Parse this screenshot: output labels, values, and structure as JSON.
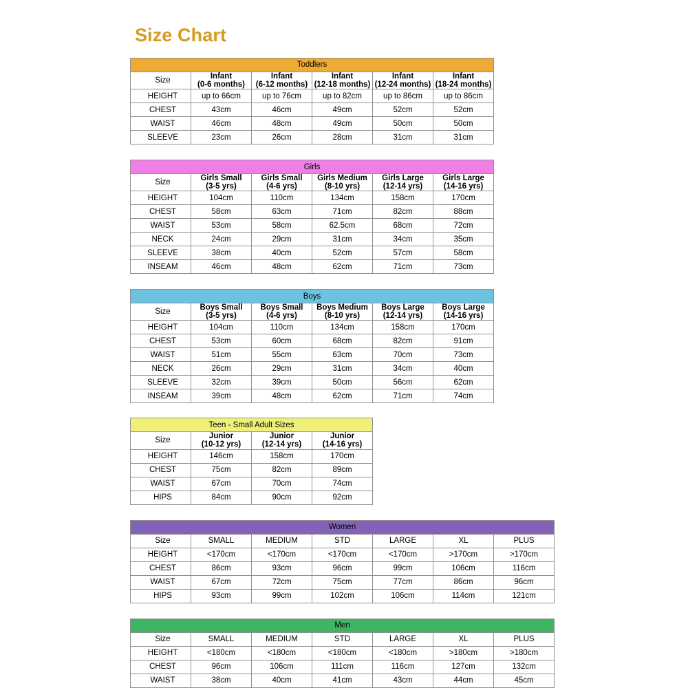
{
  "page": {
    "title": "Size Chart",
    "title_color": "#d69a20",
    "background": "#ffffff"
  },
  "chart_data": {
    "type": "table",
    "title": "Size Chart",
    "tables": [
      {
        "name": "Toddlers",
        "band_color": "#edab36",
        "size_label": "Size",
        "columns": [
          {
            "name": "Infant",
            "age": "(0-6 months)"
          },
          {
            "name": "Infant",
            "age": "(6-12 months)"
          },
          {
            "name": "Infant",
            "age": "(12-18 months)"
          },
          {
            "name": "Infant",
            "age": "(12-24 months)"
          },
          {
            "name": "Infant",
            "age": "(18-24 months)"
          }
        ],
        "rows": [
          {
            "label": "HEIGHT",
            "values": [
              "up to 66cm",
              "up to 76cm",
              "up to 82cm",
              "up to 86cm",
              "up to 86cm"
            ]
          },
          {
            "label": "CHEST",
            "values": [
              "43cm",
              "46cm",
              "49cm",
              "52cm",
              "52cm"
            ]
          },
          {
            "label": "WAIST",
            "values": [
              "46cm",
              "48cm",
              "49cm",
              "50cm",
              "50cm"
            ]
          },
          {
            "label": "SLEEVE",
            "values": [
              "23cm",
              "26cm",
              "28cm",
              "31cm",
              "31cm"
            ]
          }
        ]
      },
      {
        "name": "Girls",
        "band_color": "#ef7fe4",
        "size_label": "Size",
        "columns": [
          {
            "name": "Girls Small",
            "age": "(3-5 yrs)"
          },
          {
            "name": "Girls Small",
            "age": "(4-6 yrs)"
          },
          {
            "name": "Girls Medium",
            "age": "(8-10 yrs)"
          },
          {
            "name": "Girls Large",
            "age": "(12-14 yrs)"
          },
          {
            "name": "Girls Large",
            "age": "(14-16 yrs)"
          }
        ],
        "rows": [
          {
            "label": "HEIGHT",
            "values": [
              "104cm",
              "110cm",
              "134cm",
              "158cm",
              "170cm"
            ]
          },
          {
            "label": "CHEST",
            "values": [
              "58cm",
              "63cm",
              "71cm",
              "82cm",
              "88cm"
            ]
          },
          {
            "label": "WAIST",
            "values": [
              "53cm",
              "58cm",
              "62.5cm",
              "68cm",
              "72cm"
            ]
          },
          {
            "label": "NECK",
            "values": [
              "24cm",
              "29cm",
              "31cm",
              "34cm",
              "35cm"
            ]
          },
          {
            "label": "SLEEVE",
            "values": [
              "38cm",
              "40cm",
              "52cm",
              "57cm",
              "58cm"
            ]
          },
          {
            "label": "INSEAM",
            "values": [
              "46cm",
              "48cm",
              "62cm",
              "71cm",
              "73cm"
            ]
          }
        ]
      },
      {
        "name": "Boys",
        "band_color": "#6cc3e0",
        "size_label": "Size",
        "columns": [
          {
            "name": "Boys Small",
            "age": "(3-5 yrs)"
          },
          {
            "name": "Boys Small",
            "age": "(4-6 yrs)"
          },
          {
            "name": "Boys Medium",
            "age": "(8-10 yrs)"
          },
          {
            "name": "Boys Large",
            "age": "(12-14 yrs)"
          },
          {
            "name": "Boys Large",
            "age": "(14-16 yrs)"
          }
        ],
        "rows": [
          {
            "label": "HEIGHT",
            "values": [
              "104cm",
              "110cm",
              "134cm",
              "158cm",
              "170cm"
            ]
          },
          {
            "label": "CHEST",
            "values": [
              "53cm",
              "60cm",
              "68cm",
              "82cm",
              "91cm"
            ]
          },
          {
            "label": "WAIST",
            "values": [
              "51cm",
              "55cm",
              "63cm",
              "70cm",
              "73cm"
            ]
          },
          {
            "label": "NECK",
            "values": [
              "26cm",
              "29cm",
              "31cm",
              "34cm",
              "40cm"
            ]
          },
          {
            "label": "SLEEVE",
            "values": [
              "32cm",
              "39cm",
              "50cm",
              "56cm",
              "62cm"
            ]
          },
          {
            "label": "INSEAM",
            "values": [
              "39cm",
              "48cm",
              "62cm",
              "71cm",
              "74cm"
            ]
          }
        ]
      },
      {
        "name": "Teen - Small Adult Sizes",
        "band_color": "#eff07a",
        "size_label": "Size",
        "columns": [
          {
            "name": "Junior",
            "age": "(10-12 yrs)"
          },
          {
            "name": "Junior",
            "age": "(12-14 yrs)"
          },
          {
            "name": "Junior",
            "age": "(14-16 yrs)"
          }
        ],
        "rows": [
          {
            "label": "HEIGHT",
            "values": [
              "146cm",
              "158cm",
              "170cm"
            ]
          },
          {
            "label": "CHEST",
            "values": [
              "75cm",
              "82cm",
              "89cm"
            ]
          },
          {
            "label": "WAIST",
            "values": [
              "67cm",
              "70cm",
              "74cm"
            ]
          },
          {
            "label": "HIPS",
            "values": [
              "84cm",
              "90cm",
              "92cm"
            ]
          }
        ]
      },
      {
        "name": "Women",
        "band_color": "#8363b8",
        "size_label": "Size",
        "columns": [
          {
            "name": "SMALL",
            "age": ""
          },
          {
            "name": "MEDIUM",
            "age": ""
          },
          {
            "name": "STD",
            "age": ""
          },
          {
            "name": "LARGE",
            "age": ""
          },
          {
            "name": "XL",
            "age": ""
          },
          {
            "name": "PLUS",
            "age": ""
          }
        ],
        "rows": [
          {
            "label": "HEIGHT",
            "values": [
              "<170cm",
              "<170cm",
              "<170cm",
              "<170cm",
              ">170cm",
              ">170cm"
            ]
          },
          {
            "label": "CHEST",
            "values": [
              "86cm",
              "93cm",
              "96cm",
              "99cm",
              "106cm",
              "116cm"
            ]
          },
          {
            "label": "WAIST",
            "values": [
              "67cm",
              "72cm",
              "75cm",
              "77cm",
              "86cm",
              "96cm"
            ]
          },
          {
            "label": "HIPS",
            "values": [
              "93cm",
              "99cm",
              "102cm",
              "106cm",
              "114cm",
              "121cm"
            ]
          }
        ]
      },
      {
        "name": "Men",
        "band_color": "#3fb463",
        "size_label": "Size",
        "columns": [
          {
            "name": "SMALL",
            "age": ""
          },
          {
            "name": "MEDIUM",
            "age": ""
          },
          {
            "name": "STD",
            "age": ""
          },
          {
            "name": "LARGE",
            "age": ""
          },
          {
            "name": "XL",
            "age": ""
          },
          {
            "name": "PLUS",
            "age": ""
          }
        ],
        "rows": [
          {
            "label": "HEIGHT",
            "values": [
              "<180cm",
              "<180cm",
              "<180cm",
              "<180cm",
              ">180cm",
              ">180cm"
            ]
          },
          {
            "label": "CHEST",
            "values": [
              "96cm",
              "106cm",
              "111cm",
              "116cm",
              "127cm",
              "132cm"
            ]
          },
          {
            "label": "WAIST",
            "values": [
              "38cm",
              "40cm",
              "41cm",
              "43cm",
              "44cm",
              "45cm"
            ]
          }
        ]
      }
    ]
  }
}
